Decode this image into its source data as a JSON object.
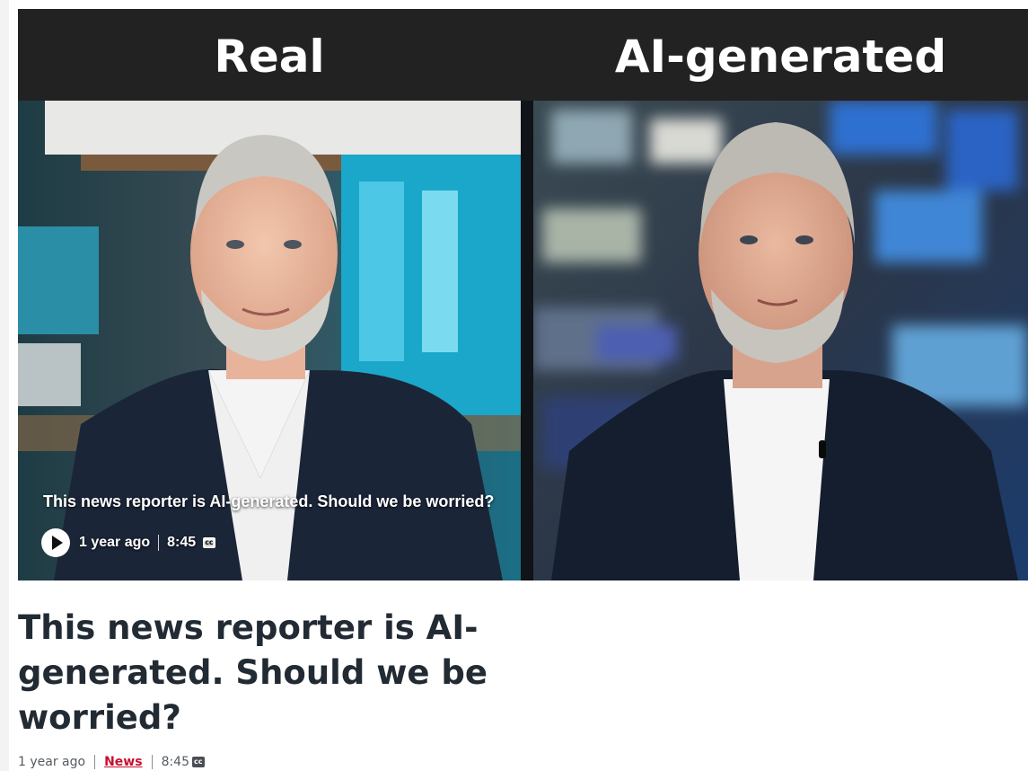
{
  "panels": {
    "left_label": "Real",
    "right_label": "AI-generated"
  },
  "video": {
    "overlay_title": "This news reporter is AI-generated. Should we be worried?",
    "time_ago": "1 year ago",
    "duration": "8:45",
    "cc_label": "cc",
    "play_icon": "play-icon"
  },
  "article": {
    "headline": "This news reporter is AI-generated. Should we be worried?",
    "time_ago": "1 year ago",
    "category": "News",
    "duration": "8:45",
    "cc_label": "cc"
  },
  "colors": {
    "header_band": "#222222",
    "headline": "#222b33",
    "category_link": "#c8102e"
  }
}
